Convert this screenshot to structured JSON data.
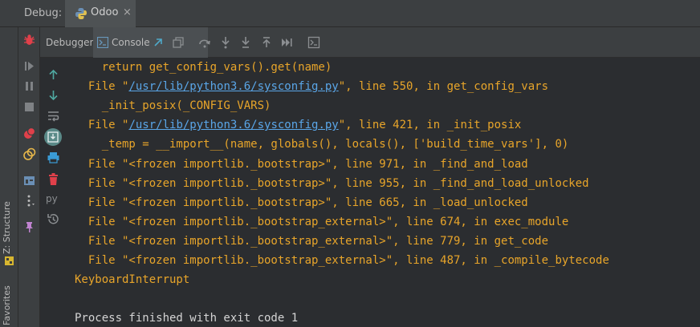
{
  "topbar": {
    "label": "Debug:",
    "tab_name": "Odoo",
    "close_glyph": "×"
  },
  "leftstrip": {
    "structure_label": "Z: Structure",
    "favorites_label": "Favorites"
  },
  "toolbar": {
    "debugger_tab": "Debugger",
    "console_tab": "Console"
  },
  "console": {
    "lines": [
      {
        "indent": "    ",
        "text": "return get_config_vars().get(name)"
      },
      {
        "indent": "  ",
        "pre": "File \"",
        "link": "/usr/lib/python3.6/sysconfig.py",
        "post": "\", line 550, in get_config_vars"
      },
      {
        "indent": "    ",
        "text": "_init_posix(_CONFIG_VARS)"
      },
      {
        "indent": "  ",
        "pre": "File \"",
        "link": "/usr/lib/python3.6/sysconfig.py",
        "post": "\", line 421, in _init_posix"
      },
      {
        "indent": "    ",
        "text": "_temp = __import__(name, globals(), locals(), ['build_time_vars'], 0)"
      },
      {
        "indent": "  ",
        "text": "File \"<frozen importlib._bootstrap>\", line 971, in _find_and_load"
      },
      {
        "indent": "  ",
        "text": "File \"<frozen importlib._bootstrap>\", line 955, in _find_and_load_unlocked"
      },
      {
        "indent": "  ",
        "text": "File \"<frozen importlib._bootstrap>\", line 665, in _load_unlocked"
      },
      {
        "indent": "  ",
        "text": "File \"<frozen importlib._bootstrap_external>\", line 674, in exec_module"
      },
      {
        "indent": "  ",
        "text": "File \"<frozen importlib._bootstrap_external>\", line 779, in get_code"
      },
      {
        "indent": "  ",
        "text": "File \"<frozen importlib._bootstrap_external>\", line 487, in _compile_bytecode"
      },
      {
        "indent": "",
        "text": "KeyboardInterrupt"
      },
      {
        "indent": "",
        "text": ""
      },
      {
        "indent": "",
        "text": "Process finished with exit code 1",
        "plain": true
      }
    ]
  },
  "colors": {
    "accent": "#e8a52a",
    "link": "#5aa6e8",
    "bg": "#2b2d30",
    "panel": "#3c3f41"
  },
  "icons": {
    "topbar": [
      "python-icon",
      "close-icon"
    ],
    "leftcol": [
      "bug-icon",
      "resume-icon",
      "pause-icon",
      "stop-icon",
      "view-breakpoints-icon",
      "mute-breakpoints-icon",
      "layout-icon",
      "more-icon",
      "pin-icon"
    ],
    "toolbar": [
      "console-icon",
      "open-external-icon",
      "restore-layout-icon",
      "step-over-icon",
      "step-into-icon",
      "step-into-my-code-icon",
      "step-out-icon",
      "run-to-cursor-icon",
      "evaluate-icon"
    ],
    "consolecol": [
      "scroll-up-icon",
      "scroll-down-icon",
      "soft-wrap-icon",
      "scroll-to-end-icon",
      "print-icon",
      "clear-icon",
      "python-prompt-icon",
      "history-icon"
    ]
  }
}
